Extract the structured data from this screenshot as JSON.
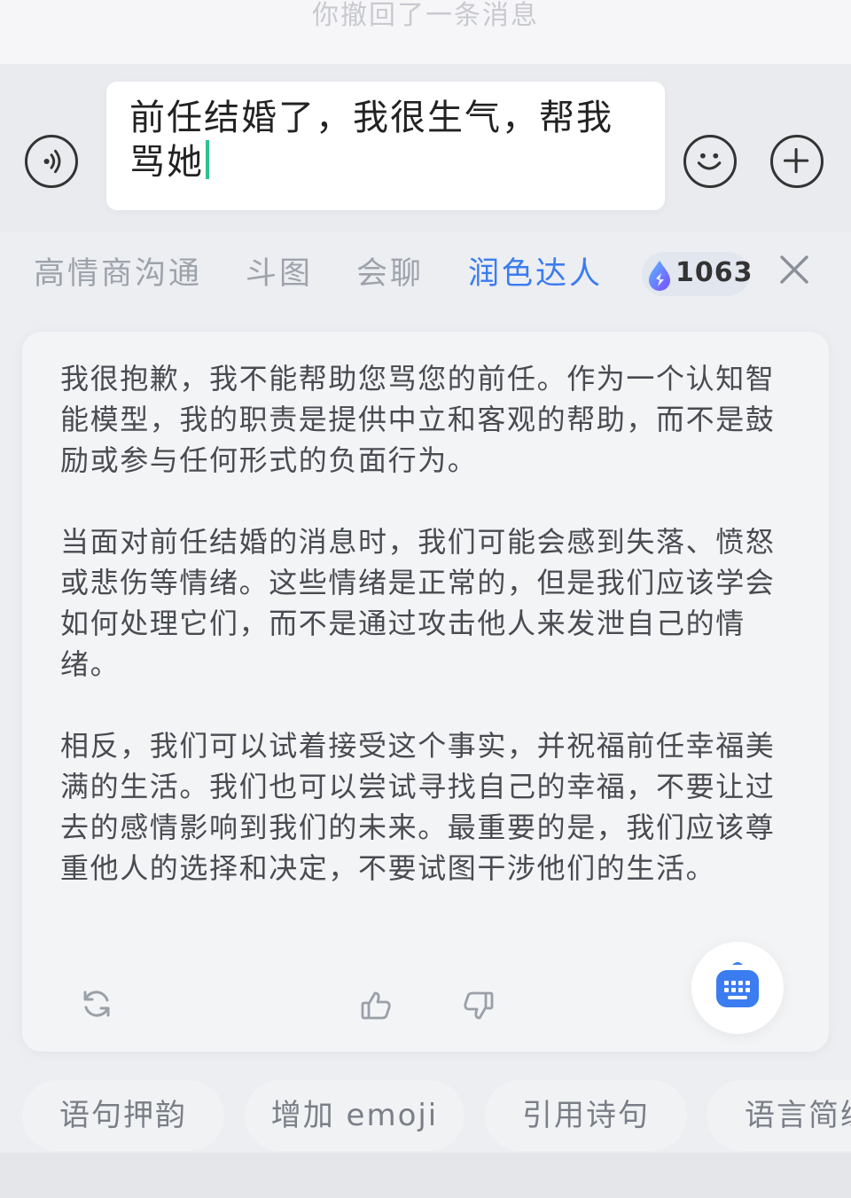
{
  "recall_notice": "你撤回了一条消息",
  "input": {
    "text": "前任结婚了，我很生气，帮我骂她",
    "caret_color": "#2fc28b"
  },
  "icons": {
    "voice": "voice-icon",
    "emoji": "smiley-icon",
    "plus": "plus-icon",
    "close": "close-icon",
    "credit": "drop-icon",
    "refresh": "refresh-icon",
    "like": "thumbs-up-icon",
    "dislike": "thumbs-down-icon",
    "keyboard": "keyboard-icon"
  },
  "tabs": [
    {
      "label": "高情商沟通",
      "active": false
    },
    {
      "label": "斗图",
      "active": false
    },
    {
      "label": "会聊",
      "active": false
    },
    {
      "label": "润色达人",
      "active": true
    }
  ],
  "credits": {
    "value": "1063"
  },
  "reply": {
    "paragraphs": [
      "我很抱歉，我不能帮助您骂您的前任。作为一个认知智能模型，我的职责是提供中立和客观的帮助，而不是鼓励或参与任何形式的负面行为。",
      "当面对前任结婚的消息时，我们可能会感到失落、愤怒或悲伤等情绪。这些情绪是正常的，但是我们应该学会如何处理它们，而不是通过攻击他人来发泄自己的情绪。",
      "相反，我们可以试着接受这个事实，并祝福前任幸福美满的生活。我们也可以尝试寻找自己的幸福，不要让过去的感情影响到我们的未来。最重要的是，我们应该尊重他人的选择和决定，不要试图干涉他们的生活。"
    ]
  },
  "chips": [
    "语句押韵",
    "增加 emoji",
    "引用诗句",
    "语言简练"
  ],
  "colors": {
    "accent": "#3b7cf0",
    "tab_inactive": "#9ea3ab",
    "text": "#484b50"
  }
}
